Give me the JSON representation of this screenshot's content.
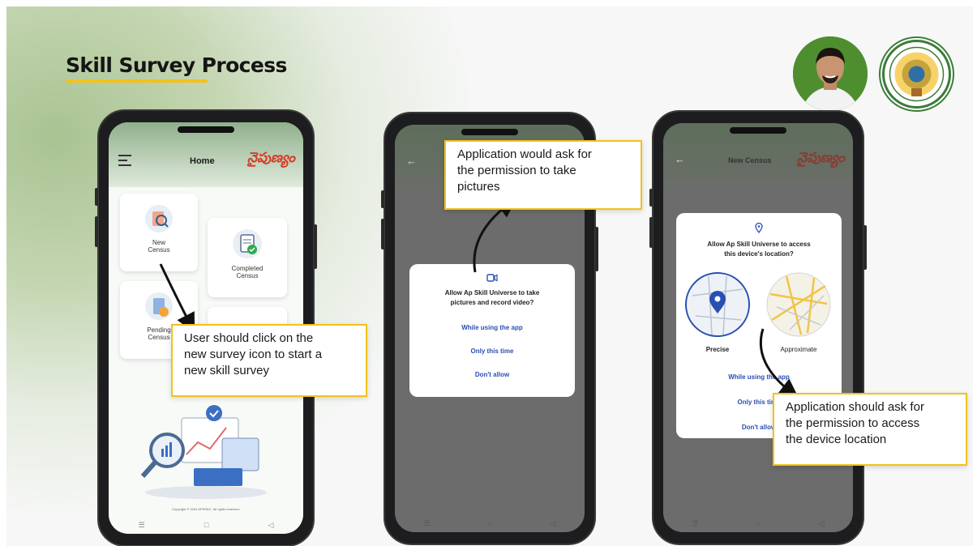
{
  "slide": {
    "title": "Skill Survey Process"
  },
  "colors": {
    "accent": "#f2c21b",
    "brand_red": "#d73c28",
    "link_blue": "#2a4fb3"
  },
  "phone1": {
    "screen_title": "Home",
    "brand_text": "నైపుణ్యం",
    "tiles": [
      {
        "label_line1": "New",
        "label_line2": "Census"
      },
      {
        "label_line1": "Completed",
        "label_line2": "Census"
      },
      {
        "label_line1": "Pending",
        "label_line2": "Census"
      }
    ],
    "footer": "Copyright © 2024 APSSDC. All rights reserved.",
    "nav": [
      "☰",
      "□",
      "◁"
    ]
  },
  "phone2": {
    "dialog_question_line1": "Allow Ap Skill Universe to take",
    "dialog_question_line2": "pictures and record video?",
    "options": [
      "While using the app",
      "Only this time",
      "Don't allow"
    ],
    "nav": [
      "☰",
      "○",
      "◁"
    ]
  },
  "phone3": {
    "screen_title": "New Census",
    "brand_text": "నైపుణ్యం",
    "dialog_question_line1": "Allow Ap Skill Universe to access",
    "dialog_question_line2": "this device's location?",
    "precise_label": "Precise",
    "approximate_label": "Approximate",
    "options": [
      "While using the app",
      "Only this time",
      "Don't allow"
    ],
    "nav": [
      "☰",
      "○",
      "◁"
    ]
  },
  "callouts": {
    "new_survey": [
      "User should click on the",
      "new survey icon to start a",
      "new skill survey"
    ],
    "camera": [
      "Application would ask for",
      "the permission to take",
      "pictures"
    ],
    "location": [
      "Application should ask for",
      "the permission to access",
      "the device location"
    ]
  }
}
